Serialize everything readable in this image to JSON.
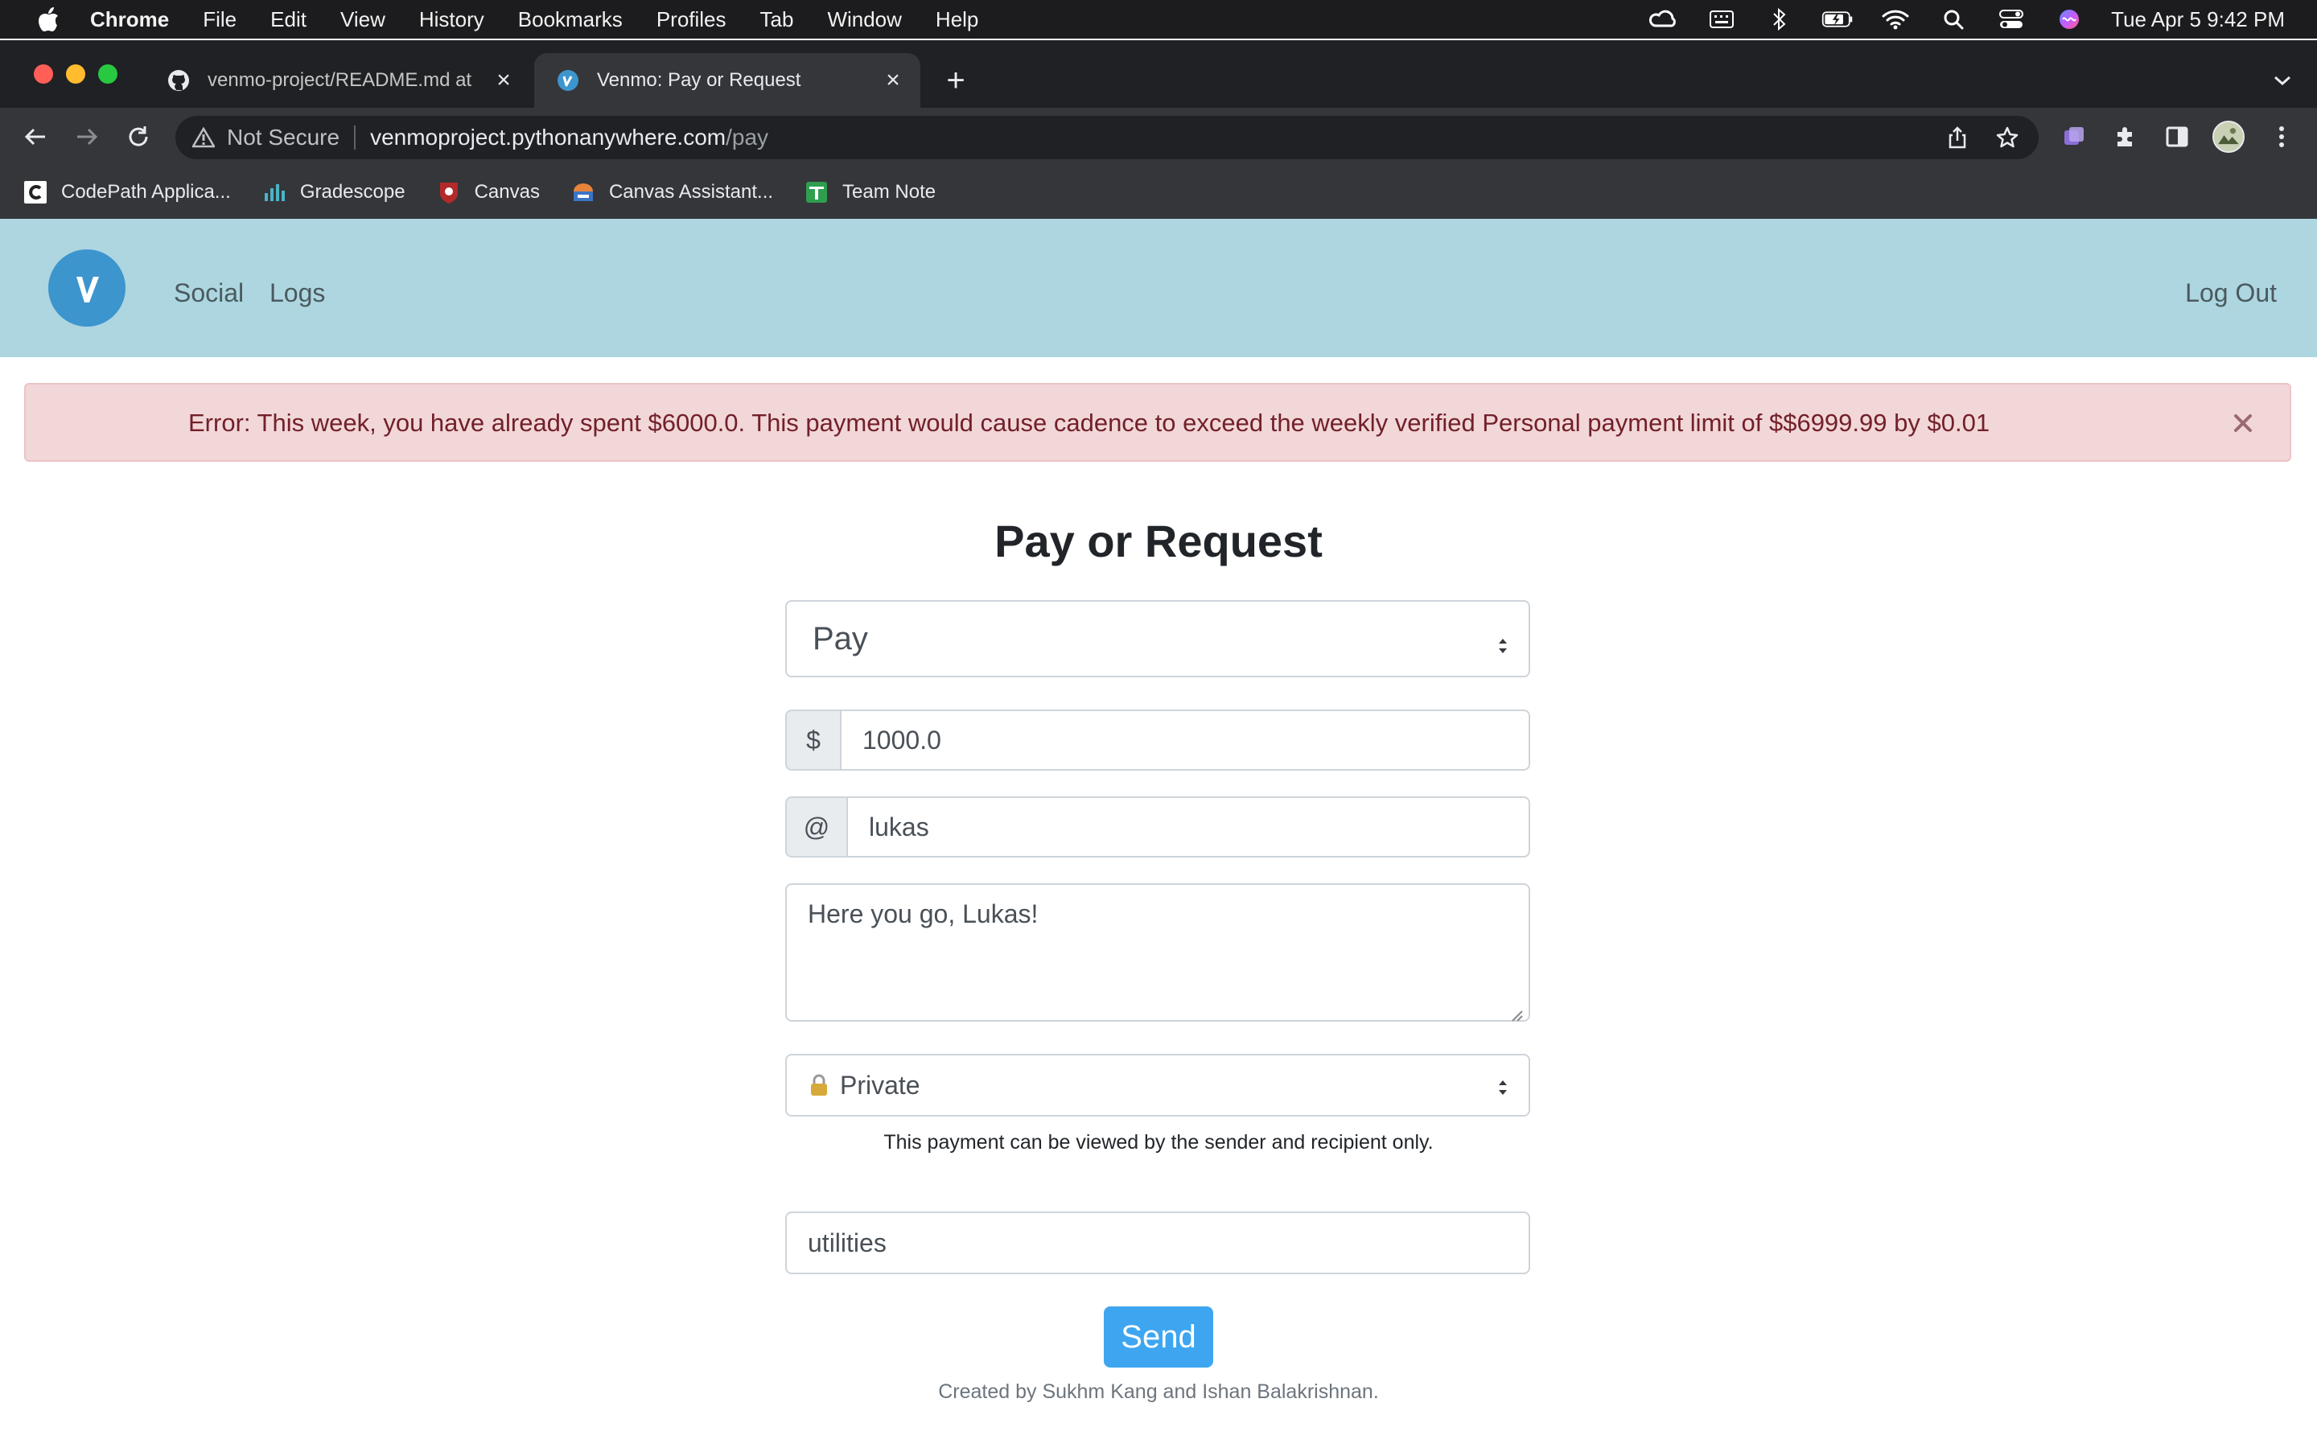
{
  "menubar": {
    "app_name": "Chrome",
    "items": [
      "File",
      "Edit",
      "View",
      "History",
      "Bookmarks",
      "Profiles",
      "Tab",
      "Window",
      "Help"
    ],
    "clock": "Tue Apr 5  9:42 PM"
  },
  "browser": {
    "tabs": [
      {
        "title": "venmo-project/README.md at",
        "favicon": "github-icon",
        "active": false
      },
      {
        "title": "Venmo: Pay or Request",
        "favicon": "venmo-icon",
        "active": true
      }
    ],
    "address": {
      "security_label": "Not Secure",
      "host": "venmoproject.pythonanywhere.com",
      "path": "/pay"
    },
    "bookmarks": [
      {
        "label": "CodePath Applica...",
        "icon": "codepath-icon"
      },
      {
        "label": "Gradescope",
        "icon": "gradescope-icon"
      },
      {
        "label": "Canvas",
        "icon": "canvas-icon"
      },
      {
        "label": "Canvas Assistant...",
        "icon": "canvas-assistant-icon"
      },
      {
        "label": "Team Note",
        "icon": "team-note-icon"
      }
    ]
  },
  "site": {
    "nav": {
      "social": "Social",
      "logs": "Logs",
      "logout": "Log Out"
    },
    "alert": "Error: This week, you have already spent $6000.0. This payment would cause cadence to exceed the weekly verified Personal payment limit of $$6999.99 by $0.01",
    "title": "Pay or Request",
    "form": {
      "action_value": "Pay",
      "amount_prefix": "$",
      "amount_value": "1000.0",
      "recipient_prefix": "@",
      "recipient_value": "lukas",
      "note_value": "Here you go, Lukas!",
      "privacy_value": "Private",
      "privacy_help": "This payment can be viewed by the sender and recipient only.",
      "tag_value": "utilities",
      "send_label": "Send"
    },
    "footer": "Created by Sukhm Kang and Ishan Balakrishnan."
  },
  "colors": {
    "nav_bg": "#add6e0",
    "alert_bg": "#f2d7d9",
    "alert_text": "#722029",
    "send_bg": "#3ea6f0",
    "logo_bg": "#3d95ce"
  }
}
